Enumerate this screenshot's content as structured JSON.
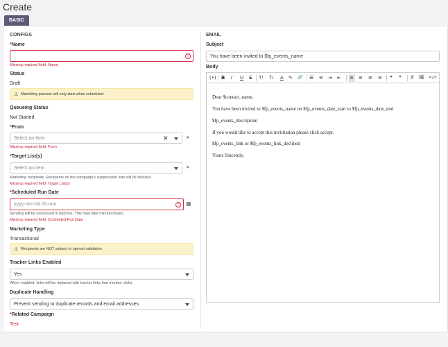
{
  "page": {
    "title": "Create"
  },
  "tabs": [
    {
      "label": "BASIC"
    }
  ],
  "configs": {
    "section_title": "CONFIGS",
    "name": {
      "required_mark": "*",
      "label": "Name",
      "value": "",
      "error": "Missing required field: Name"
    },
    "status": {
      "label": "Status",
      "value": "Draft",
      "notice": "Marketing process will only start when scheduled."
    },
    "queueing_status": {
      "label": "Queueing Status",
      "value": "Not Started"
    },
    "from": {
      "required_mark": "*",
      "label": "From",
      "placeholder": "Select an Item",
      "error": "Missing required field: From"
    },
    "target_lists": {
      "required_mark": "*",
      "label": "Target List(s)",
      "placeholder": "Select an item",
      "help": "Marketing recipients. Recipients on the campaign's suppression lists will be blocked.",
      "error": "Missing required field: Target List(s)"
    },
    "scheduled_run_date": {
      "required_mark": "*",
      "label": "Scheduled Run Date",
      "placeholder": "yyyy-mm-dd hh:mm",
      "help": "Sending will be processed in batches. This may take minutes/hours.",
      "error": "Missing required field: Scheduled Run Date"
    },
    "marketing_type": {
      "label": "Marketing Type",
      "value": "Transactional",
      "notice": "Recipients are NOT subject to opt-out validation."
    },
    "tracker_links": {
      "label": "Tracker Links Enabled",
      "value": "Yes",
      "help": "When enabled, links will be replaced with tracker links that monitor clicks."
    },
    "duplicate_handling": {
      "label": "Duplicate Handling",
      "value": "Prevent sending to duplicate records and email addresses"
    },
    "related_campaign": {
      "required_mark": "*",
      "label": "Related Campaign",
      "value": "Test"
    }
  },
  "email": {
    "section_title": "EMAIL",
    "subject": {
      "label": "Subject",
      "value": "You have been invited to $fp_events_name"
    },
    "body": {
      "label": "Body",
      "lines": [
        "Dear $contact_name,",
        "You have been invited to $fp_events_name on $fp_events_date_start to $fp_events_date_end",
        "$fp_events_description",
        "If you would like to accept this invititation please click accept.",
        " $fp_events_link or $fp_events_link_declined",
        "Yours Sincerely,"
      ]
    },
    "toolbar": {
      "source": "(•)",
      "bold": "B",
      "italic": "I",
      "underline": "U",
      "strikethrough": "S",
      "superscript": "T¹",
      "subscript": "T₁",
      "font_color": "A",
      "highlight": "✎",
      "link": "🔗",
      "bullet_list": "☰",
      "numbered_list": "≡",
      "indent": "⇥",
      "outdent": "⇤",
      "align_left": "≡",
      "align_center": "≡",
      "align_right": "≡",
      "justify": "≡",
      "blockquote": "❝",
      "quote_close": "❞",
      "clear_format": "Ⱦ",
      "image": "🖼",
      "code": "</>"
    }
  },
  "icons": {
    "error": "!",
    "clear": "✕",
    "cursor": "➤",
    "calendar": "▦",
    "warning": "⚠"
  }
}
